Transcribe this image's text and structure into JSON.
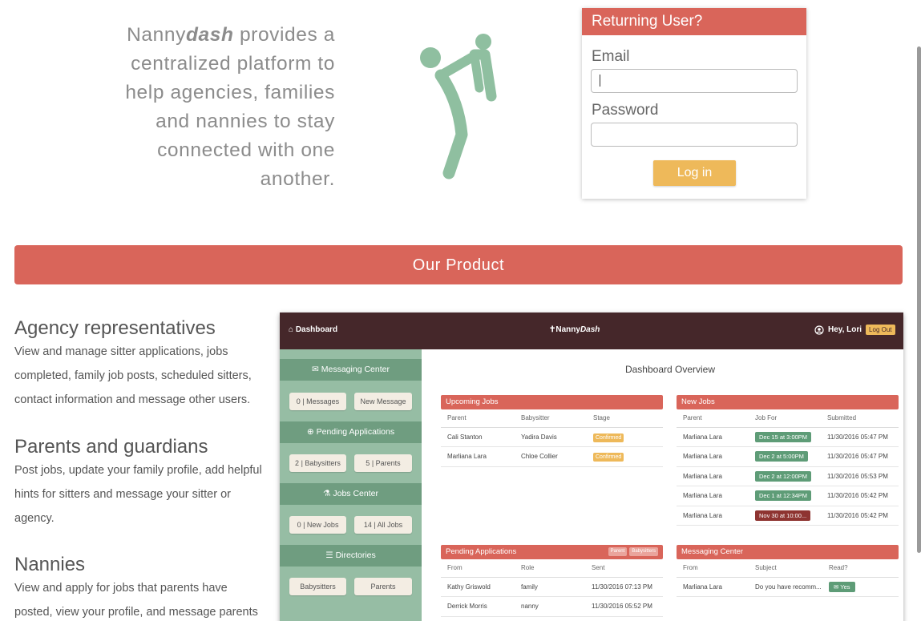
{
  "hero": {
    "brand_plain": "Nanny",
    "brand_bold": "dash",
    "tagline_rest": " provides a centralized platform to help agencies, families and nannies to stay connected with one another."
  },
  "login": {
    "title": "Returning User?",
    "email_label": "Email",
    "email_value": "",
    "password_label": "Password",
    "password_value": "",
    "button": "Log in"
  },
  "product_bar": "Our Product",
  "features": [
    {
      "title": "Agency representatives",
      "text": "View and manage sitter applications, jobs completed, family job posts, scheduled sitters, contact information and message other users."
    },
    {
      "title": "Parents and guardians",
      "text": "Post jobs, update your family profile, add helpful hints for sitters and message your sitter or agency."
    },
    {
      "title": "Nannies",
      "text": "View and apply for jobs that parents have posted, view your profile, and message parents"
    }
  ],
  "dashboard": {
    "nav_left": "Dashboard",
    "nav_brand_plain": "Nanny",
    "nav_brand_bold": "Dash",
    "nav_greeting": "Hey, Lori",
    "logout": "Log Out",
    "overview_title": "Dashboard Overview",
    "sidebar": {
      "messaging_center": "Messaging Center",
      "messages_count": "0",
      "messages_label": "Messages",
      "new_message": "New Message",
      "pending_applications": "Pending Applications",
      "babysitters_count": "2",
      "babysitters_label": "Babysitters",
      "parents_count": "5",
      "parents_label": "Parents",
      "jobs_center": "Jobs Center",
      "new_jobs_count": "0",
      "new_jobs_label": "New Jobs",
      "all_jobs_count": "14",
      "all_jobs_label": "All Jobs",
      "directories": "Directories",
      "dir_babysitters": "Babysitters",
      "dir_parents": "Parents"
    },
    "upcoming_jobs": {
      "title": "Upcoming Jobs",
      "columns": [
        "Parent",
        "Babysitter",
        "Stage"
      ],
      "rows": [
        [
          "Cali Stanton",
          "Yadira Davis",
          "Confirmed"
        ],
        [
          "Marliana Lara",
          "Chloe Collier",
          "Confirmed"
        ]
      ]
    },
    "new_jobs": {
      "title": "New Jobs",
      "columns": [
        "Parent",
        "Job For",
        "Submitted"
      ],
      "rows": [
        [
          "Marliana Lara",
          "Dec 15 at 3:00PM",
          "11/30/2016 05:47 PM"
        ],
        [
          "Marliana Lara",
          "Dec 2 at 5:00PM",
          "11/30/2016 05:47 PM"
        ],
        [
          "Marliana Lara",
          "Dec 2 at 12:00PM",
          "11/30/2016 05:53 PM"
        ],
        [
          "Marliana Lara",
          "Dec 1 at 12:34PM",
          "11/30/2016 05:42 PM"
        ],
        [
          "Marliana Lara",
          "Nov 30 at 10:00...",
          "11/30/2016 05:42 PM"
        ]
      ]
    },
    "pending_applications": {
      "title": "Pending Applications",
      "tag_parent": "Parent",
      "tag_babysitters": "Babysitters",
      "columns": [
        "From",
        "Role",
        "Sent"
      ],
      "rows": [
        [
          "Kathy Griswold",
          "family",
          "11/30/2016 07:13 PM"
        ],
        [
          "Derrick Morris",
          "nanny",
          "11/30/2016 05:52 PM"
        ]
      ]
    },
    "messaging_center": {
      "title": "Messaging Center",
      "columns": [
        "From",
        "Subject",
        "Read?"
      ],
      "rows": [
        [
          "Marliana Lara",
          "Do you have recomm...",
          "Yes"
        ]
      ]
    }
  },
  "colors": {
    "accent_red": "#d9655a",
    "accent_yellow": "#eeb95a",
    "sage_green": "#96bda4",
    "nav_dark": "#45272a"
  }
}
